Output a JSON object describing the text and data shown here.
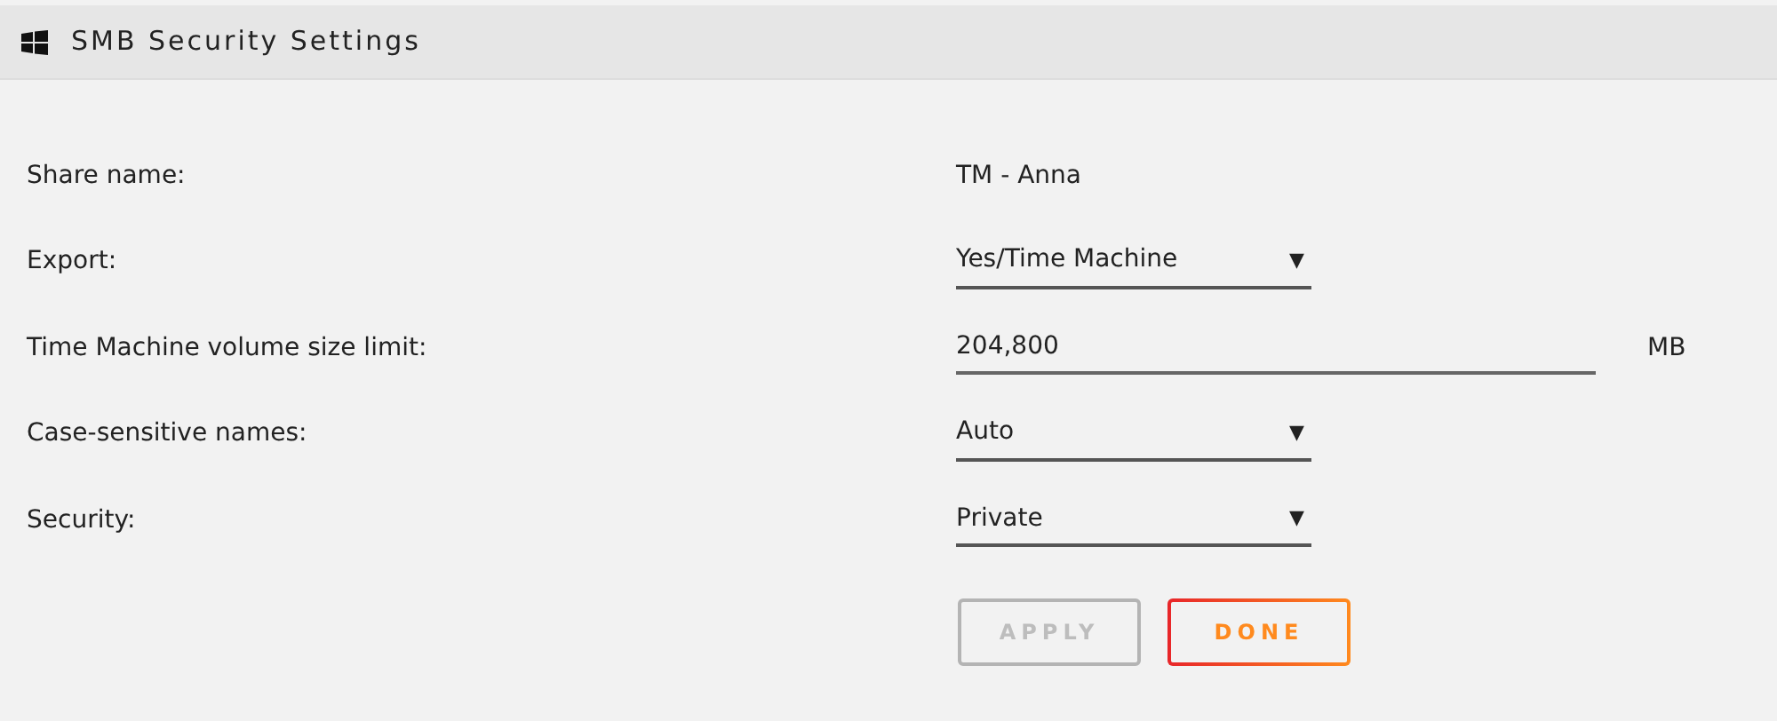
{
  "header": {
    "title": "SMB Security Settings"
  },
  "fields": [
    {
      "kind": "text",
      "label": "Share name:",
      "value": "TM - Anna"
    },
    {
      "kind": "select",
      "label": "Export:",
      "value": "Yes/Time Machine",
      "arrow": "▼"
    },
    {
      "kind": "input",
      "label": "Time Machine volume size limit:",
      "value": "204,800",
      "unit": "MB"
    },
    {
      "kind": "select",
      "label": "Case-sensitive names:",
      "value": "Auto",
      "arrow": "▼"
    },
    {
      "kind": "select",
      "label": "Security:",
      "value": "Private",
      "arrow": "▼"
    }
  ],
  "buttons": [
    {
      "label": "APPLY",
      "disabled": true
    },
    {
      "label": "DONE",
      "disabled": false
    }
  ]
}
